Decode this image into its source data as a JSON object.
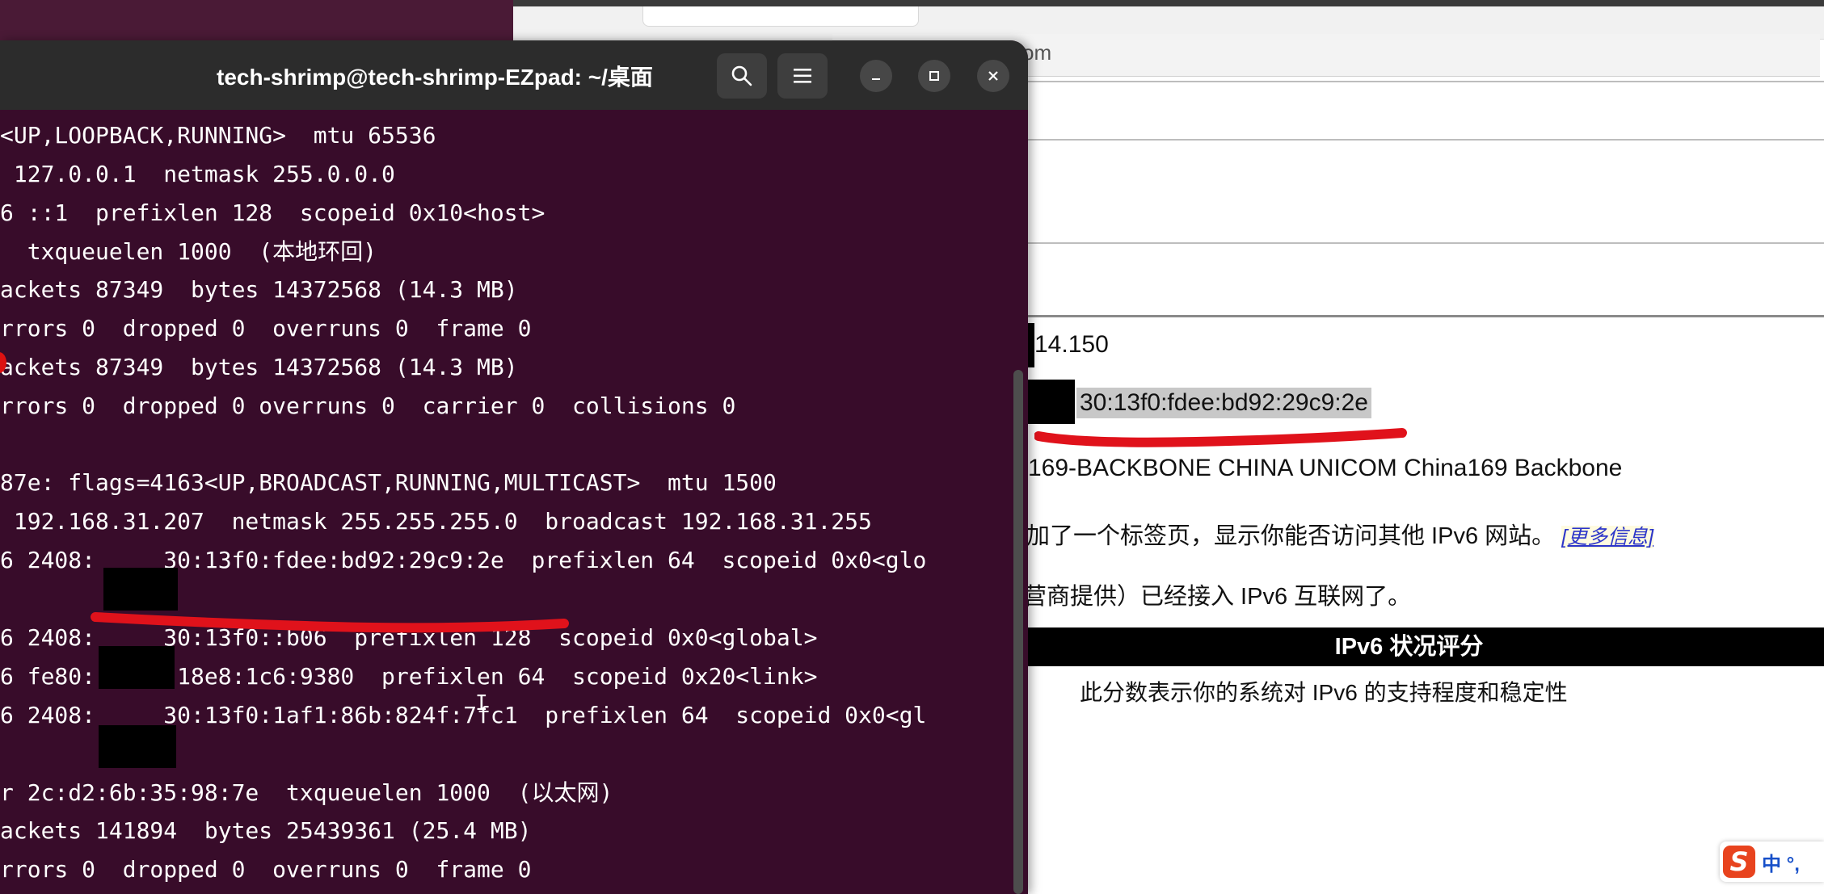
{
  "terminal": {
    "title": "tech-shrimp@tech-shrimp-EZpad: ~/桌面",
    "lines": [
      "<UP,LOOPBACK,RUNNING>  mtu 65536",
      " 127.0.0.1  netmask 255.0.0.0",
      "6 ::1  prefixlen 128  scopeid 0x10<host>",
      "  txqueuelen 1000  (本地环回)",
      "ackets 87349  bytes 14372568 (14.3 MB)",
      "rrors 0  dropped 0  overruns 0  frame 0",
      "ackets 87349  bytes 14372568 (14.3 MB)",
      "rrors 0  dropped 0 overruns 0  carrier 0  collisions 0",
      "",
      "87e: flags=4163<UP,BROADCAST,RUNNING,MULTICAST>  mtu 1500",
      " 192.168.31.207  netmask 255.255.255.0  broadcast 192.168.31.255",
      "6 2408:     30:13f0:fdee:bd92:29c9:2e  prefixlen 64  scopeid 0x0<glo",
      "",
      "6 2408:     30:13f0::b06  prefixlen 128  scopeid 0x0<global>",
      "6 fe80::753c:18e8:1c6:9380  prefixlen 64  scopeid 0x20<link>",
      "6 2408:     30:13f0:1af1:86b:824f:7fc1  prefixlen 64  scopeid 0x0<gl",
      "",
      "r 2c:d2:6b:35:98:7e  txqueuelen 1000  (以太网)",
      "ackets 141894  bytes 25439361 (25.4 MB)",
      "rrors 0  dropped 0  overruns 0  frame 0"
    ],
    "buttons": {
      "search": "search-icon",
      "menu": "hamburger-menu-icon",
      "minimize": "minimize-icon",
      "maximize": "maximize-icon",
      "close": "close-icon"
    }
  },
  "browser": {
    "url_fragment": "om",
    "ipv4_partial": "14.150",
    "ipv6_partial": "30:13f0:fdee:bd92:29c9:2e",
    "isp": "169-BACKBONE CHINA UNICOM China169 Backbone",
    "tab_notice": "加了一个标签页，显示你能否访问其他 IPv6 网站。",
    "more_info": "[更多信息]",
    "connected": "营商提供）已经接入 IPv6 互联网了。",
    "score_title": "IPv6 状况评分",
    "score_desc": "此分数表示你的系统对 IPv6 的支持程度和稳定性"
  },
  "ime": {
    "label": "中 °,"
  },
  "colors": {
    "terminal_bg": "#380c2a",
    "terminal_header": "#2c2c2c",
    "annotation_red": "#e0121b",
    "link_blue": "#2c35c9"
  }
}
